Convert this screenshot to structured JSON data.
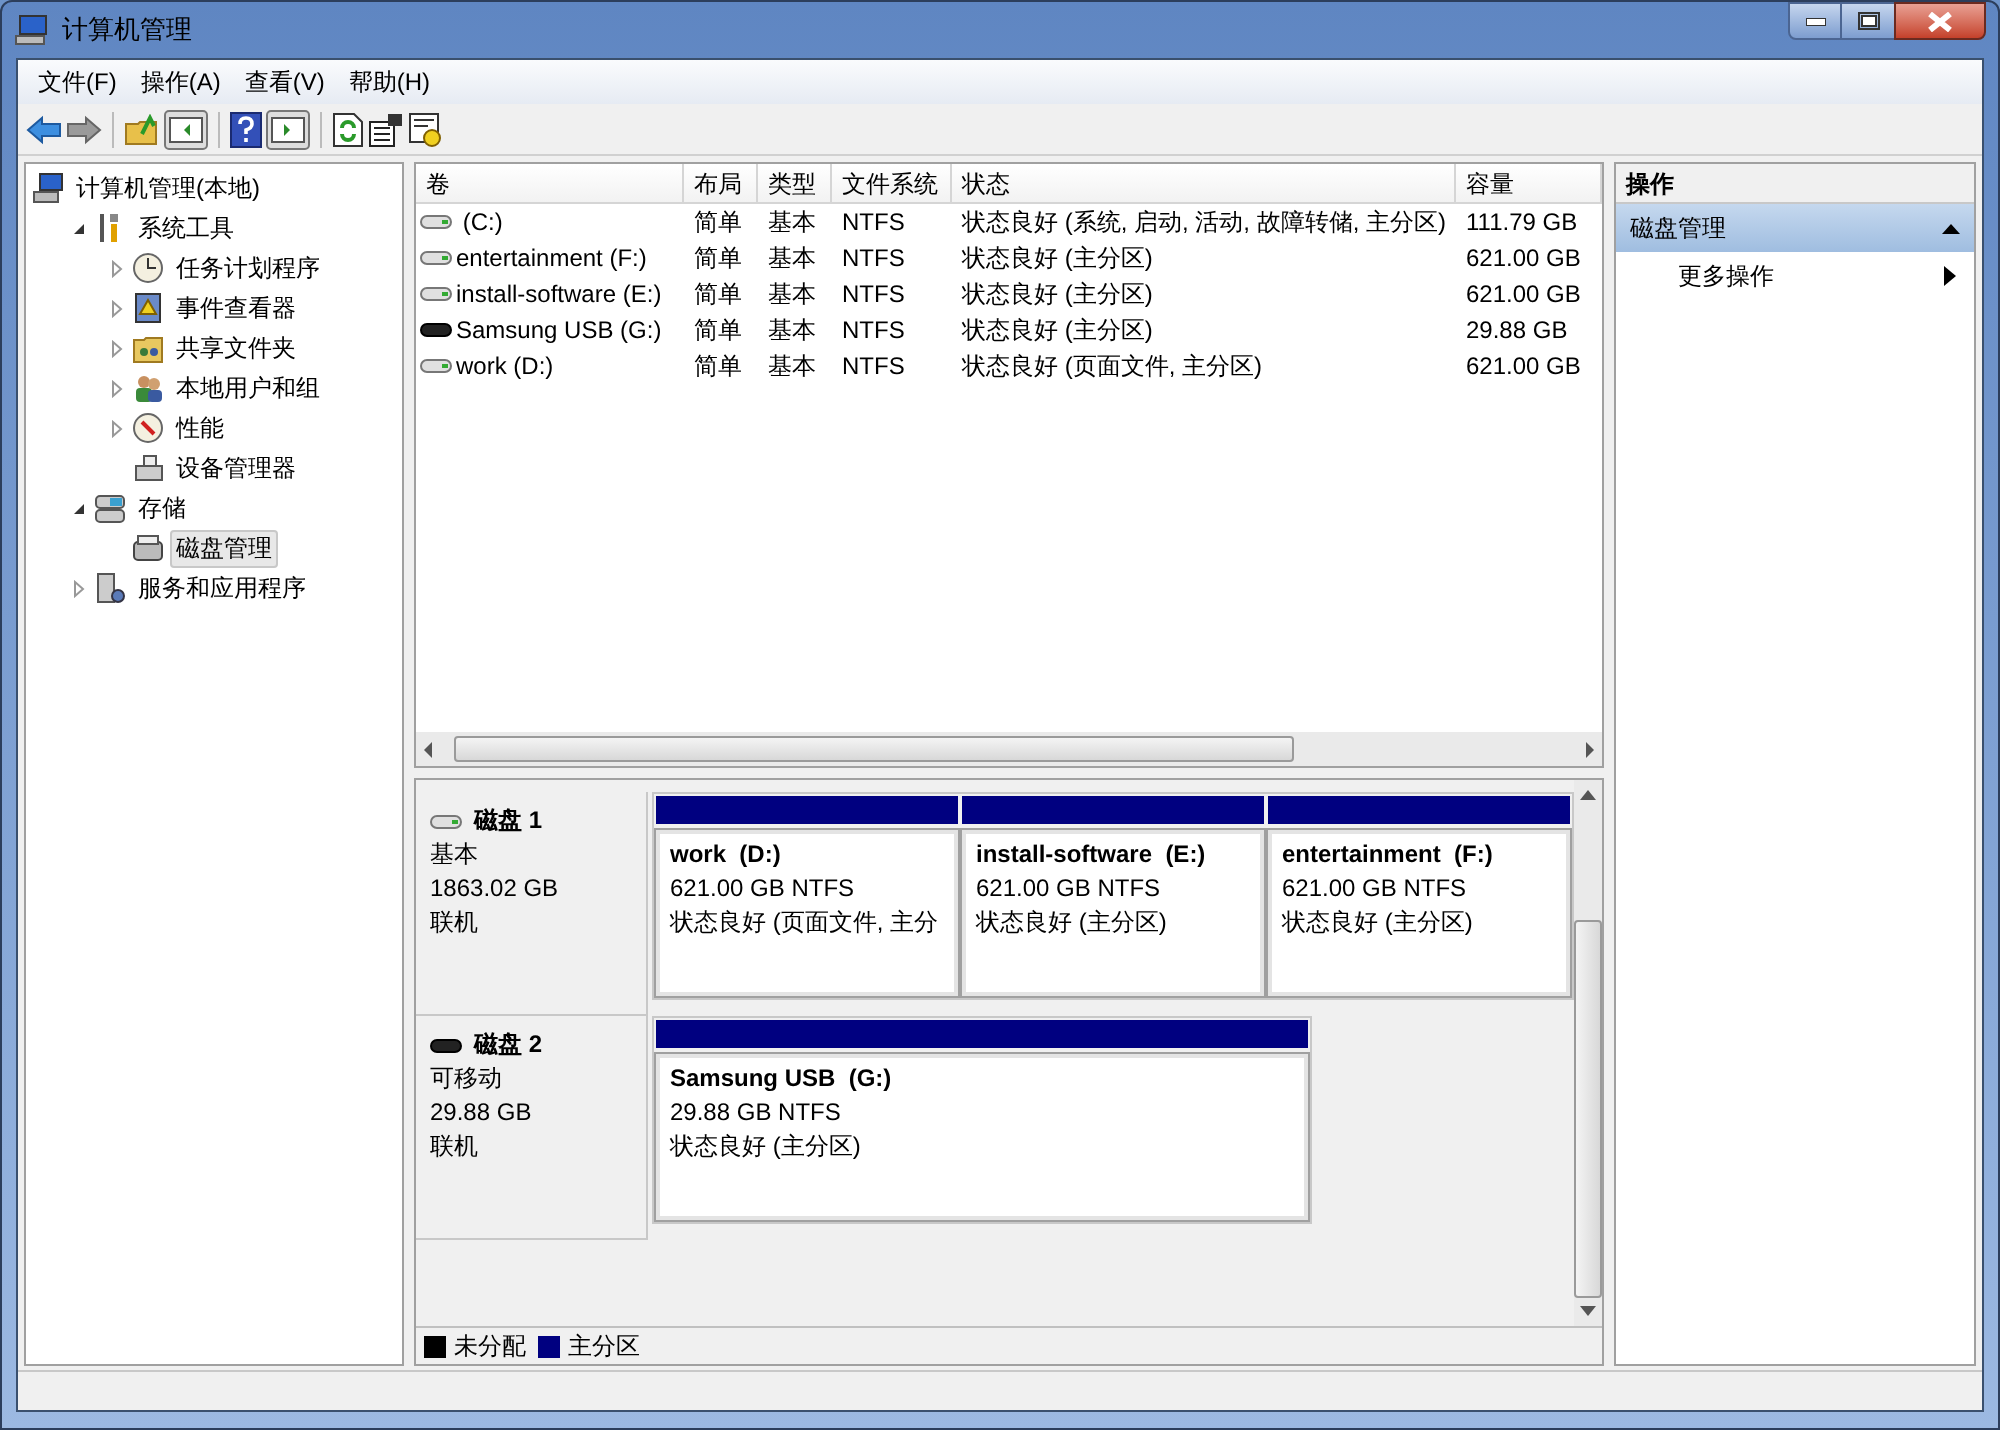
{
  "window": {
    "title": "计算机管理"
  },
  "menu": [
    "文件(F)",
    "操作(A)",
    "查看(V)",
    "帮助(H)"
  ],
  "tree": [
    {
      "label": "计算机管理(本地)",
      "kind": "root",
      "selected": false,
      "children": [
        {
          "label": "系统工具",
          "kind": "node",
          "expanded": true,
          "selected": false,
          "children": [
            {
              "label": "任务计划程序",
              "kind": "node",
              "expanded": false,
              "selected": false
            },
            {
              "label": "事件查看器",
              "kind": "node",
              "expanded": false,
              "selected": false
            },
            {
              "label": "共享文件夹",
              "kind": "node",
              "expanded": false,
              "selected": false
            },
            {
              "label": "本地用户和组",
              "kind": "node",
              "expanded": false,
              "selected": false
            },
            {
              "label": "性能",
              "kind": "node",
              "expanded": false,
              "selected": false
            },
            {
              "label": "设备管理器",
              "kind": "leaf",
              "selected": false
            }
          ]
        },
        {
          "label": "存储",
          "kind": "node",
          "expanded": true,
          "selected": false,
          "children": [
            {
              "label": "磁盘管理",
              "kind": "leaf",
              "selected": true
            }
          ]
        },
        {
          "label": "服务和应用程序",
          "kind": "node",
          "expanded": false,
          "selected": false
        }
      ]
    }
  ],
  "table": {
    "columns": [
      "卷",
      "布局",
      "类型",
      "文件系统",
      "状态",
      "容量"
    ],
    "rows": [
      {
        "kind": "fixed",
        "cells": [
          " (C:)",
          "简单",
          "基本",
          "NTFS",
          "状态良好 (系统, 启动, 活动, 故障转储, 主分区)",
          "111.79 GB"
        ]
      },
      {
        "kind": "fixed",
        "cells": [
          "entertainment (F:)",
          "简单",
          "基本",
          "NTFS",
          "状态良好 (主分区)",
          "621.00 GB"
        ]
      },
      {
        "kind": "fixed",
        "cells": [
          "install-software (E:)",
          "简单",
          "基本",
          "NTFS",
          "状态良好 (主分区)",
          "621.00 GB"
        ]
      },
      {
        "kind": "removable",
        "cells": [
          "Samsung USB (G:)",
          "简单",
          "基本",
          "NTFS",
          "状态良好 (主分区)",
          "29.88 GB"
        ]
      },
      {
        "kind": "fixed",
        "cells": [
          "work (D:)",
          "简单",
          "基本",
          "NTFS",
          "状态良好 (页面文件, 主分区)",
          "621.00 GB"
        ]
      }
    ]
  },
  "disks": [
    {
      "kind": "fixed",
      "name": "磁盘 1",
      "type": "基本",
      "size": "1863.02 GB",
      "state": "联机",
      "partitions": [
        {
          "name": "work  (D:)",
          "size": "621.00 GB NTFS",
          "status": "状态良好 (页面文件, 主分",
          "color": "#000080"
        },
        {
          "name": "install-software  (E:)",
          "size": "621.00 GB NTFS",
          "status": "状态良好 (主分区)",
          "color": "#000080"
        },
        {
          "name": "entertainment  (F:)",
          "size": "621.00 GB NTFS",
          "status": "状态良好 (主分区)",
          "color": "#000080"
        }
      ]
    },
    {
      "kind": "removable",
      "name": "磁盘 2",
      "type": "可移动",
      "size": "29.88 GB",
      "state": "联机",
      "partitions": [
        {
          "name": "Samsung USB  (G:)",
          "size": "29.88 GB NTFS",
          "status": "状态良好 (主分区)",
          "color": "#000080"
        }
      ]
    }
  ],
  "legend": [
    {
      "label": "未分配",
      "color": "#000000"
    },
    {
      "label": "主分区",
      "color": "#000080"
    }
  ],
  "actions": {
    "title": "操作",
    "section": {
      "label": "磁盘管理",
      "expanded": true
    },
    "items": [
      {
        "label": "更多操作"
      }
    ]
  }
}
